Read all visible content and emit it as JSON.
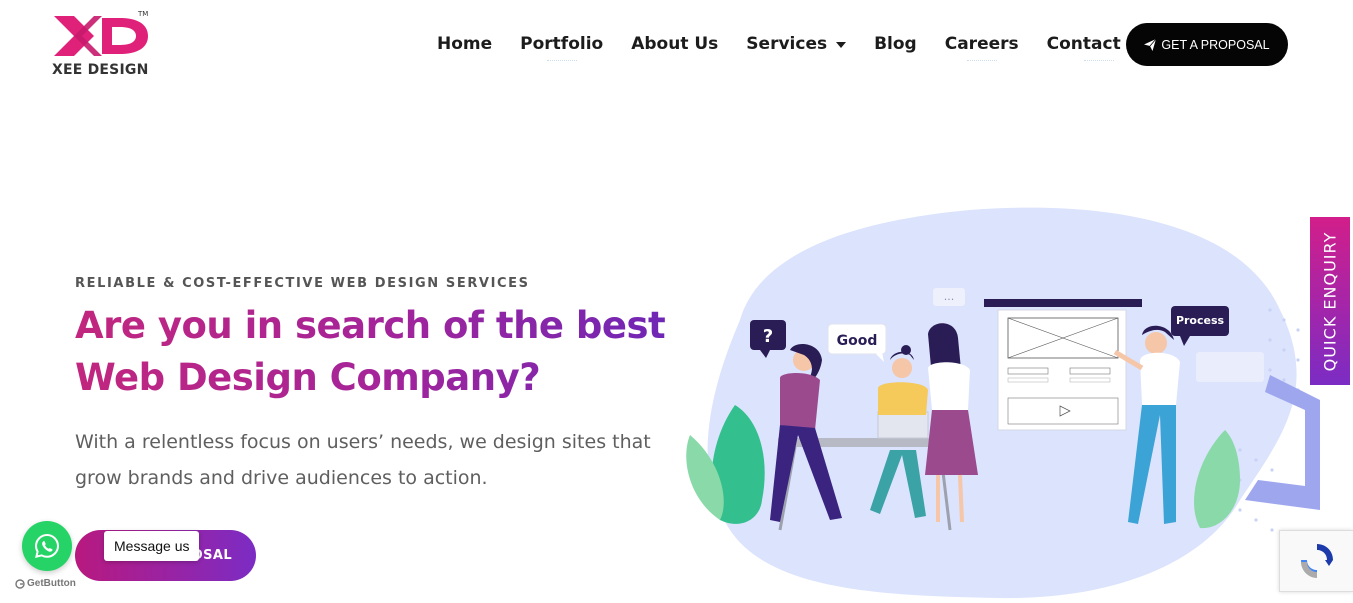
{
  "header": {
    "logo_text": "XEE DESIGN",
    "tm": "TM",
    "nav": [
      {
        "label": "Home"
      },
      {
        "label": "Portfolio"
      },
      {
        "label": "About Us"
      },
      {
        "label": "Services",
        "has_dropdown": true
      },
      {
        "label": "Blog"
      },
      {
        "label": "Careers"
      },
      {
        "label": "Contact Us"
      }
    ],
    "cta_label": "GET A PROPOSAL"
  },
  "hero": {
    "eyebrow": "RELIABLE & COST-EFFECTIVE WEB DESIGN SERVICES",
    "headline": "Are you in search of the best Web Design Company?",
    "lede": "With a relentless focus on users’ needs, we design sites that grow brands and drive audiences to action.",
    "cta_label": "OSAL"
  },
  "illustration": {
    "bubble_question": "?",
    "bubble_good": "Good",
    "bubble_dots": "...",
    "bubble_process": "Process"
  },
  "quick_enquiry_label": "QUICK ENQUIRY",
  "whatsapp": {
    "message_label": "Message us",
    "getbutton_label": "GetButton"
  },
  "colors": {
    "brand_pink": "#e0217a",
    "gradient_start": "#c2267e",
    "gradient_end": "#6a27b8",
    "nav_text": "#1c1c1c",
    "whatsapp_green": "#25d366"
  }
}
